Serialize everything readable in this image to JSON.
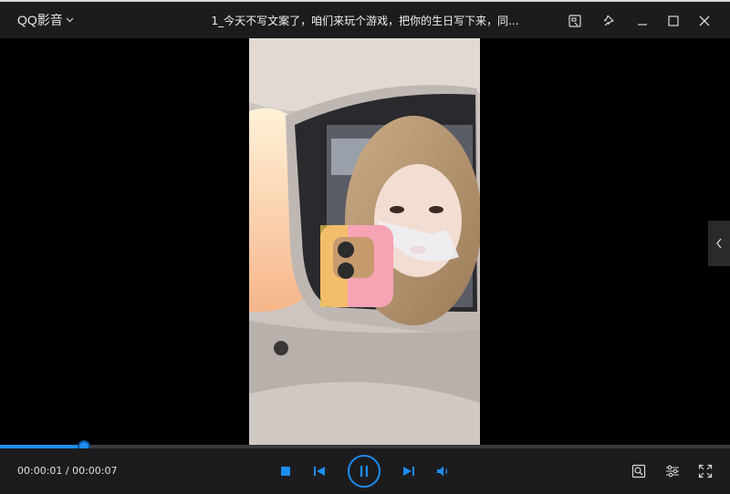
{
  "app": {
    "name": "QQ影音",
    "title": "1_今天不写文案了，咱们来玩个游戏，把你的生日写下来，同..."
  },
  "window_controls": [
    "snapshot-icon",
    "pin-icon",
    "minimize-icon",
    "maximize-icon",
    "close-icon"
  ],
  "player": {
    "current_time": "00:00:01",
    "duration": "00:00:07",
    "time_display": "00:00:01 / 00:00:07",
    "progress_fraction": 0.115,
    "state": "playing"
  },
  "controls": {
    "left": [
      "stop-icon",
      "previous-icon"
    ],
    "center": "pause-icon",
    "right_of_center": [
      "next-icon",
      "volume-icon"
    ],
    "far_right": [
      "screenshot-search-icon",
      "settings-icon",
      "fullscreen-icon"
    ]
  },
  "colors": {
    "accent": "#1d8cf0",
    "titlebar": "#1c1c1e",
    "background": "#000000"
  }
}
